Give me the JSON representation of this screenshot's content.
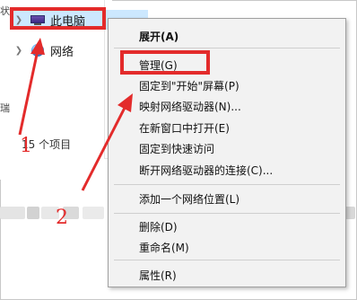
{
  "nav": {
    "this_pc": "此电脑",
    "network": "网络",
    "status": "15 个项目"
  },
  "context_menu": {
    "items": [
      "展开(A)",
      "管理(G)",
      "固定到\"开始\"屏幕(P)",
      "映射网络驱动器(N)...",
      "在新窗口中打开(E)",
      "固定到快速访问",
      "断开网络驱动器的连接(C)...",
      "添加一个网络位置(L)",
      "删除(D)",
      "重命名(M)",
      "属性(R)"
    ]
  },
  "annotations": {
    "step1": "1",
    "step2": "2"
  },
  "colors": {
    "highlight": "#e32b2b",
    "selection": "#cce8ff",
    "menu_bg": "#f2f2f2"
  }
}
